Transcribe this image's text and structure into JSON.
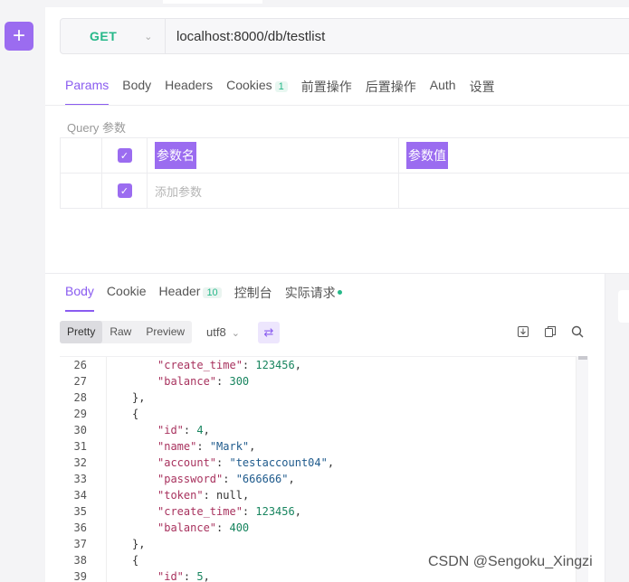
{
  "sidebar": {
    "add_label": "+"
  },
  "request": {
    "method": "GET",
    "url": "localhost:8000/db/testlist"
  },
  "request_tabs": [
    {
      "label": "Params",
      "active": true
    },
    {
      "label": "Body"
    },
    {
      "label": "Headers"
    },
    {
      "label": "Cookies",
      "badge": "1"
    },
    {
      "label": "前置操作"
    },
    {
      "label": "后置操作"
    },
    {
      "label": "Auth"
    },
    {
      "label": "设置"
    }
  ],
  "query": {
    "title": "Query 参数",
    "header": {
      "key": "参数名",
      "value": "参数值"
    },
    "add_placeholder": "添加参数"
  },
  "response_tabs": [
    {
      "label": "Body",
      "active": true
    },
    {
      "label": "Cookie"
    },
    {
      "label": "Header",
      "badge": "10"
    },
    {
      "label": "控制台"
    },
    {
      "label": "实际请求"
    }
  ],
  "format_bar": {
    "modes": [
      "Pretty",
      "Raw",
      "Preview"
    ],
    "active_mode": "Pretty",
    "encoding": "utf8",
    "icons": [
      "download-icon",
      "copy-icon",
      "search-icon"
    ]
  },
  "code_lines": [
    {
      "n": "26",
      "indent": 2,
      "key": "create_time",
      "val": "123456",
      "type": "num",
      "comma": true
    },
    {
      "n": "27",
      "indent": 2,
      "key": "balance",
      "val": "300",
      "type": "num",
      "comma": false
    },
    {
      "n": "28",
      "indent": 1,
      "raw": "},"
    },
    {
      "n": "29",
      "indent": 1,
      "raw": "{"
    },
    {
      "n": "30",
      "indent": 2,
      "key": "id",
      "val": "4",
      "type": "num",
      "comma": true
    },
    {
      "n": "31",
      "indent": 2,
      "key": "name",
      "val": "\"Mark\"",
      "type": "str",
      "comma": true
    },
    {
      "n": "32",
      "indent": 2,
      "key": "account",
      "val": "\"testaccount04\"",
      "type": "str",
      "comma": true
    },
    {
      "n": "33",
      "indent": 2,
      "key": "password",
      "val": "\"666666\"",
      "type": "str",
      "comma": true
    },
    {
      "n": "34",
      "indent": 2,
      "key": "token",
      "val": "null",
      "type": "null",
      "comma": true
    },
    {
      "n": "35",
      "indent": 2,
      "key": "create_time",
      "val": "123456",
      "type": "num",
      "comma": true
    },
    {
      "n": "36",
      "indent": 2,
      "key": "balance",
      "val": "400",
      "type": "num",
      "comma": false
    },
    {
      "n": "37",
      "indent": 1,
      "raw": "},"
    },
    {
      "n": "38",
      "indent": 1,
      "raw": "{"
    },
    {
      "n": "39",
      "indent": 2,
      "key": "id",
      "val": "5",
      "type": "num",
      "comma": true
    }
  ],
  "watermark": "CSDN @Sengoku_Xingzi"
}
